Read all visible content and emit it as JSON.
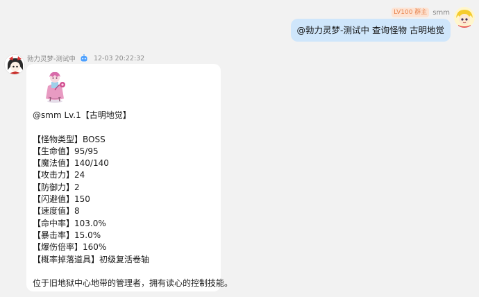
{
  "outgoing": {
    "badge": "LV100 群主",
    "sender": "smm",
    "text": "@勃力灵梦-测试中 查询怪物 古明地觉"
  },
  "incoming": {
    "sender": "勃力灵梦-测试中",
    "timestamp": "12-03 20:22:32",
    "mention_line": "@smm Lv.1【古明地觉】",
    "stats": [
      "【怪物类型】BOSS",
      "【生命值】95/95",
      "【魔法值】140/140",
      "【攻击力】24",
      "【防御力】2",
      "【闪避值】150",
      "【速度值】8",
      "【命中率】103.0%",
      "【暴击率】15.0%",
      "【爆伤倍率】160%",
      "【概率掉落道具】初级复活卷轴"
    ],
    "description": "位于旧地狱中心地带的管理者，拥有读心的控制技能。"
  },
  "colors": {
    "background": "#f2f2f2",
    "outgoing_bubble": "#cfe6fb",
    "incoming_bubble": "#ffffff",
    "badge_bg": "#fde3d3",
    "badge_text": "#e8854f"
  },
  "icons": {
    "bot": "robot-icon",
    "outgoing_avatar": "yellow-hair-character-avatar",
    "incoming_avatar": "reimu-character-avatar",
    "monster": "satori-sprite"
  }
}
